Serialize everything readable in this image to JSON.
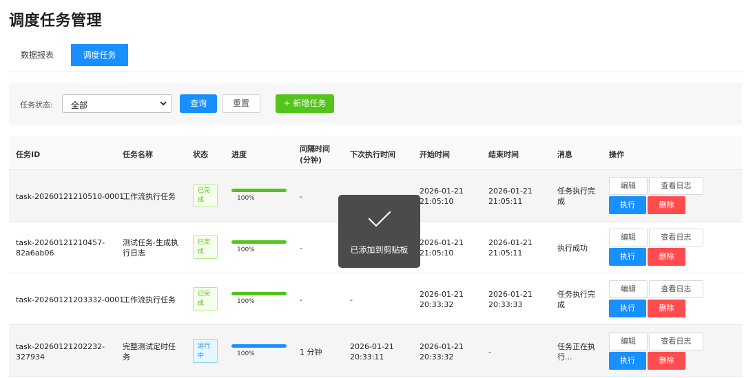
{
  "page_title": "调度任务管理",
  "tabs": [
    {
      "label": "数据报表",
      "active": false
    },
    {
      "label": "调度任务",
      "active": true
    }
  ],
  "filter": {
    "status_label": "任务状态:",
    "status_value": "全部",
    "query_button": "查询",
    "reset_button": "重置",
    "add_button": "+ 新增任务"
  },
  "table": {
    "headers": {
      "id": "任务ID",
      "name": "任务名称",
      "status": "状态",
      "progress": "进度",
      "interval_1": "间隔时间",
      "interval_2": "(分钟)",
      "next_run": "下次执行时间",
      "start": "开始时间",
      "end": "结束时间",
      "message": "消息",
      "actions": "操作"
    },
    "rows": [
      {
        "id_1": "task-20260121210510-0001",
        "id_2": "",
        "name_1": "工作流执行任务",
        "name_2": "",
        "status_1": "已完",
        "status_2": "成",
        "status_type": "done",
        "progress": 100,
        "progress_text": "100%",
        "interval": "-",
        "next_run_1": "",
        "next_run_2": "",
        "start_1": "2026-01-21",
        "start_2": "21:05:10",
        "end_1": "2026-01-21",
        "end_2": "21:05:11",
        "message_1": "任务执行完",
        "message_2": "成"
      },
      {
        "id_1": "task-20260121210457-",
        "id_2": "82a6ab06",
        "name_1": "测试任务-生成执",
        "name_2": "行日志",
        "status_1": "已完",
        "status_2": "成",
        "status_type": "done",
        "progress": 100,
        "progress_text": "100%",
        "interval": "-",
        "next_run_1": "",
        "next_run_2": "",
        "start_1": "2026-01-21",
        "start_2": "21:05:10",
        "end_1": "2026-01-21",
        "end_2": "21:05:11",
        "message_1": "执行成功",
        "message_2": ""
      },
      {
        "id_1": "task-20260121203332-0001",
        "id_2": "",
        "name_1": "工作流执行任务",
        "name_2": "",
        "status_1": "已完",
        "status_2": "成",
        "status_type": "done",
        "progress": 100,
        "progress_text": "100%",
        "interval": "-",
        "next_run_1": "-",
        "next_run_2": "",
        "start_1": "2026-01-21",
        "start_2": "20:33:32",
        "end_1": "2026-01-21",
        "end_2": "20:33:33",
        "message_1": "任务执行完",
        "message_2": "成"
      },
      {
        "id_1": "task-20260121202232-",
        "id_2": "327934",
        "name_1": "完整测试定时任",
        "name_2": "务",
        "status_1": "运行",
        "status_2": "中",
        "status_type": "running",
        "progress": 100,
        "progress_text": "100%",
        "interval": "1 分钟",
        "next_run_1": "2026-01-21",
        "next_run_2": "20:33:11",
        "start_1": "2026-01-21",
        "start_2": "20:33:32",
        "end_1": "-",
        "end_2": "",
        "message_1": "任务正在执",
        "message_2": "行..."
      }
    ],
    "action_labels": {
      "edit": "编辑",
      "view_log": "查看日志",
      "execute": "执行",
      "delete": "删除"
    }
  },
  "toast": {
    "message": "已添加到剪贴板",
    "icon": "checkmark-icon"
  },
  "colors": {
    "primary": "#1890ff",
    "success": "#52c41a",
    "danger": "#ff4d4f"
  }
}
